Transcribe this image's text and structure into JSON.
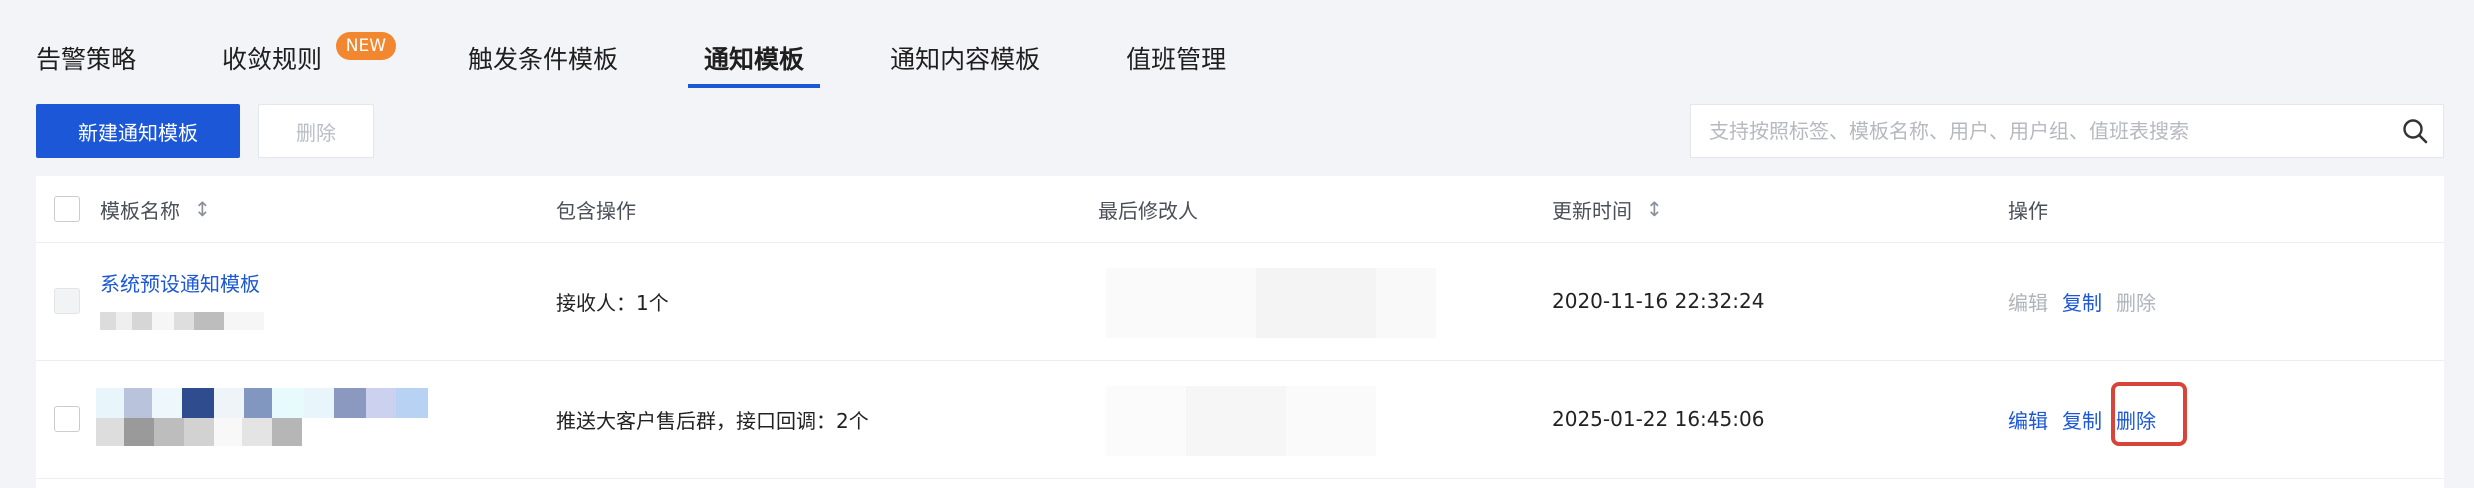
{
  "tabs": [
    {
      "label": "告警策略"
    },
    {
      "label": "收敛规则",
      "badge": "NEW"
    },
    {
      "label": "触发条件模板"
    },
    {
      "label": "通知模板",
      "active": true
    },
    {
      "label": "通知内容模板"
    },
    {
      "label": "值班管理"
    }
  ],
  "toolbar": {
    "create_label": "新建通知模板",
    "delete_label": "删除",
    "search_placeholder": "支持按照标签、模板名称、用户、用户组、值班表搜索"
  },
  "table": {
    "columns": [
      "模板名称",
      "包含操作",
      "最后修改人",
      "更新时间",
      "操作"
    ],
    "rows": [
      {
        "name": "系统预设通知模板",
        "operations": "接收人：1个",
        "updated": "2020-11-16 22:32:24",
        "actions": [
          "编辑",
          "复制",
          "删除"
        ]
      },
      {
        "name": "",
        "operations": "推送大客户售后群，接口回调：2个",
        "updated": "2025-01-22 16:45:06",
        "actions": [
          "编辑",
          "复制",
          "删除"
        ]
      }
    ]
  },
  "colors": {
    "accent": "#1b57d6",
    "badge": "#f2872f",
    "highlight": "#d9443a"
  }
}
